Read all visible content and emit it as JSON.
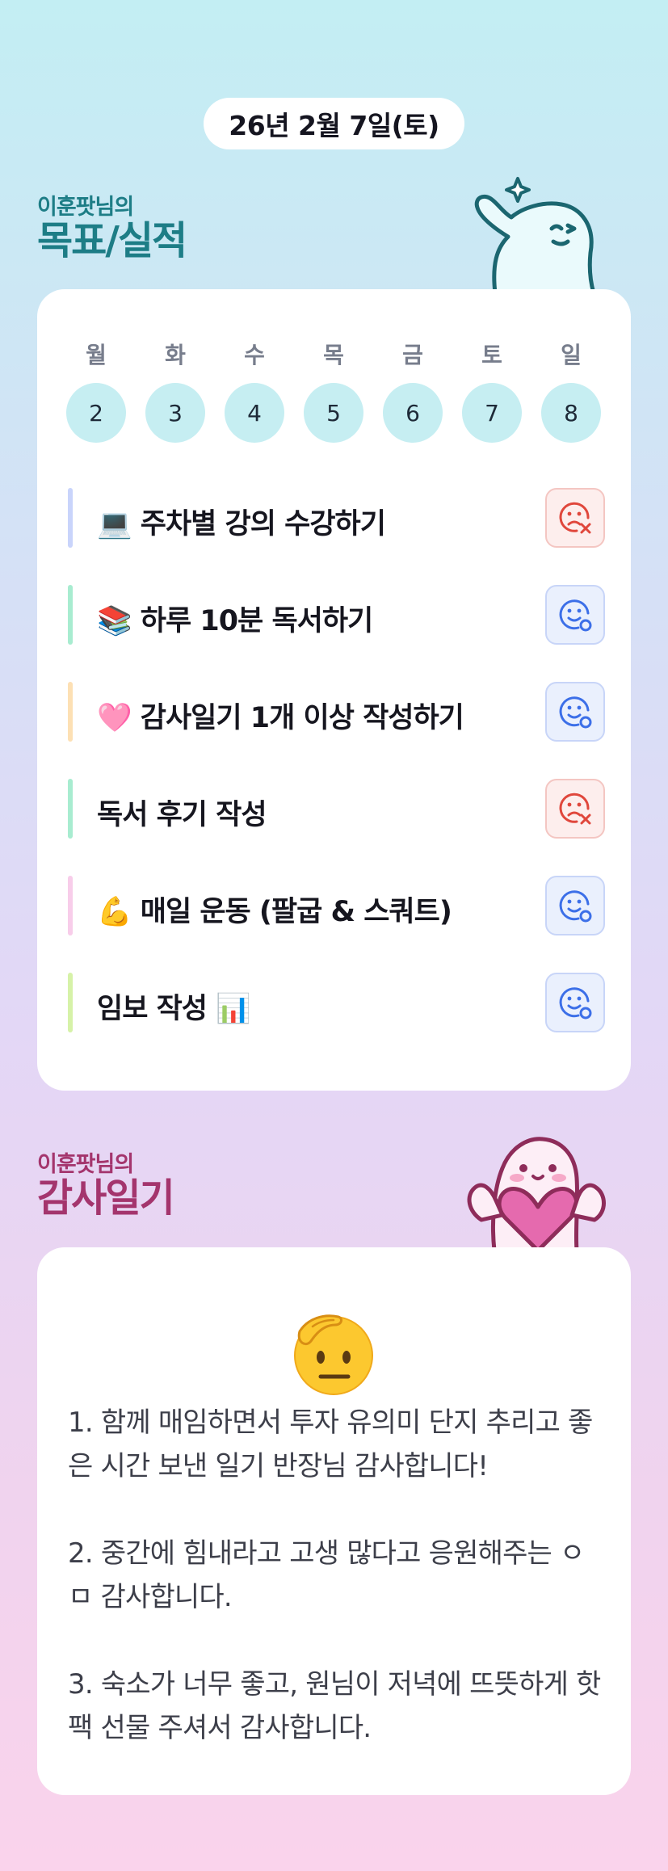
{
  "date_label": "26년 2월 7일(토)",
  "goals_section": {
    "subtitle": "이훈팟님의",
    "title": "목표/실적"
  },
  "week": [
    {
      "day": "월",
      "date": "2"
    },
    {
      "day": "화",
      "date": "3"
    },
    {
      "day": "수",
      "date": "4"
    },
    {
      "day": "목",
      "date": "5"
    },
    {
      "day": "금",
      "date": "6"
    },
    {
      "day": "토",
      "date": "7"
    },
    {
      "day": "일",
      "date": "8"
    }
  ],
  "goals": [
    {
      "label": "💻 주차별 강의 수강하기",
      "status": "fail",
      "bar_color": "#c9d4fb"
    },
    {
      "label": "📚 하루 10분 독서하기",
      "status": "done",
      "bar_color": "#a8ecd0"
    },
    {
      "label": "🩷 감사일기 1개 이상 작성하기",
      "status": "done",
      "bar_color": "#fde0b4"
    },
    {
      "label": "독서 후기 작성",
      "status": "fail",
      "bar_color": "#a8ecd0"
    },
    {
      "label": "💪 매일 운동 (팔굽 & 스쿼트)",
      "status": "done",
      "bar_color": "#f8cdea"
    },
    {
      "label": "임보 작성 📊",
      "status": "done",
      "bar_color": "#d6f2a8"
    }
  ],
  "gratitude_section": {
    "subtitle": "이훈팟님의",
    "title": "감사일기"
  },
  "gratitude_entries": [
    "1. 함께 매임하면서 투자 유의미 단지 추리고 좋은 시간 보낸 일기 반장님 감사합니다!",
    "2. 중간에 힘내라고 고생 많다고 응원해주는 ㅇㅁ 감사합니다.",
    "3. 숙소가 너무 좋고, 원님이 저녁에 뜨뜻하게 핫팩 선물 주셔서 감사합니다."
  ],
  "colors": {
    "fail": "#e0473c",
    "done": "#3c6fe8",
    "goal_title": "#1d7d86",
    "gratitude_title": "#a4356d"
  },
  "icons": {
    "fail": "sad-face-x-icon",
    "done": "smile-face-check-icon",
    "gratitude_emoji": "saluting-face-icon"
  }
}
